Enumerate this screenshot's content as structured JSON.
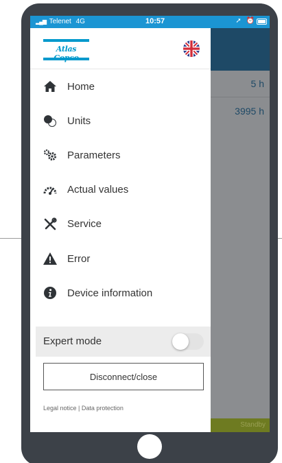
{
  "status_bar": {
    "carrier": "Telenet",
    "network": "4G",
    "time": "10:57"
  },
  "brand": {
    "logo_text": "Atlas Copco",
    "logo_color": "#0099cc",
    "language_flag_icon": "uk-flag-icon"
  },
  "menu": [
    {
      "label": "Home",
      "icon": "home-icon"
    },
    {
      "label": "Units",
      "icon": "units-icon"
    },
    {
      "label": "Parameters",
      "icon": "gears-icon"
    },
    {
      "label": "Actual values",
      "icon": "gauge-icon"
    },
    {
      "label": "Service",
      "icon": "tools-icon"
    },
    {
      "label": "Error",
      "icon": "warning-icon"
    },
    {
      "label": "Device information",
      "icon": "info-icon"
    }
  ],
  "expert_mode": {
    "label": "Expert mode",
    "enabled": false
  },
  "disconnect_label": "Disconnect/close",
  "legal": {
    "notice": "Legal notice",
    "separator": " | ",
    "data_protection": "Data protection"
  },
  "background": {
    "row1_value": "5 h",
    "row2_value": "3995 h",
    "status": "Standby",
    "header_color": "#1e4966",
    "status_color": "#6e7b21"
  },
  "colors": {
    "status_bar": "#1b95d3",
    "device_frame": "#3c4148",
    "expert_row_bg": "#ececec"
  }
}
